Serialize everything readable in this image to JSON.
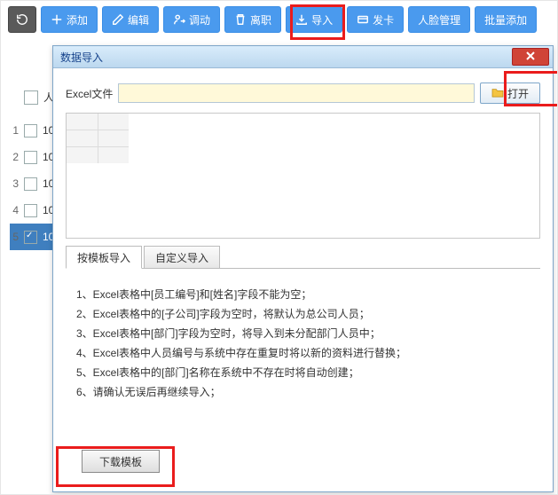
{
  "toolbar": {
    "add": "添加",
    "edit": "编辑",
    "transfer": "调动",
    "leave": "离职",
    "import": "导入",
    "card": "发卡",
    "face": "人脸管理",
    "batch": "批量添加"
  },
  "table": {
    "header": "人",
    "rows": [
      {
        "n": "1",
        "v": "10"
      },
      {
        "n": "2",
        "v": "10"
      },
      {
        "n": "3",
        "v": "10"
      },
      {
        "n": "4",
        "v": "10"
      },
      {
        "n": "5",
        "v": "10"
      }
    ]
  },
  "dialog": {
    "title": "数据导入",
    "fileLabel": "Excel文件",
    "openBtn": "打开",
    "tabs": [
      "按模板导入",
      "自定义导入"
    ],
    "rules": [
      "1、Excel表格中[员工编号]和[姓名]字段不能为空；",
      "2、Excel表格中的[子公司]字段为空时，将默认为总公司人员；",
      "3、Excel表格中[部门]字段为空时，将导入到未分配部门人员中；",
      "4、Excel表格中人员编号与系统中存在重复时将以新的资料进行替换；",
      "5、Excel表格中的[部门]名称在系统中不存在时将自动创建；",
      "6、请确认无误后再继续导入；"
    ],
    "downloadBtn": "下载模板"
  }
}
